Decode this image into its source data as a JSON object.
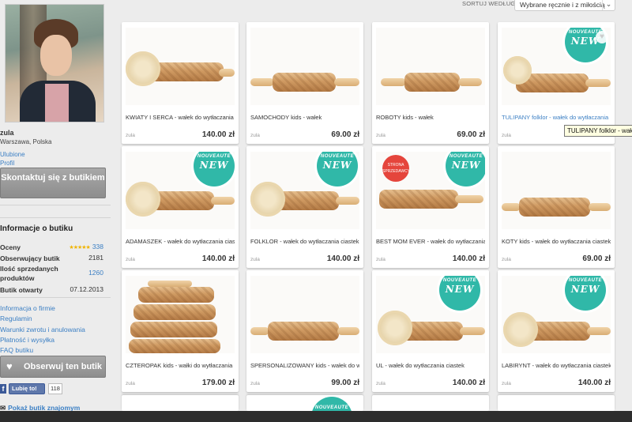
{
  "sidebar": {
    "seller_name": "zula",
    "location": "Warszawa, Polska",
    "favorites_link": "Ulubione",
    "profile_link": "Profil",
    "contact_button": "Skontaktuj się z butikiem",
    "info_title": "Informacje o butiku",
    "info": [
      {
        "label": "Oceny",
        "value": "338",
        "stars": "★★★★★"
      },
      {
        "label": "Obserwujący butik",
        "value": "2181"
      },
      {
        "label": "Ilość sprzedanych produktów",
        "value": "1260"
      },
      {
        "label": "Butik otwarty",
        "value": "07.12.2013"
      }
    ],
    "links": [
      "Informacja o firmie",
      "Regulamin",
      "Warunki zwrotu i anulowania",
      "Płatność i wysyłka",
      "FAQ butiku"
    ],
    "follow_button": "Obserwuj ten butik",
    "fb_like": "Lubię to!",
    "fb_count": "118",
    "show_friends": "Pokaż butik znajomym"
  },
  "sort": {
    "label": "SORTUJ WEDŁUG",
    "selected": "Wybrane ręcznie i z miłością"
  },
  "badge": {
    "fr": "NOUVEAUTE",
    "en": "NEW"
  },
  "red_badge": "STRONA SPRZEDAWCY",
  "tooltip": "TULIPANY folklor - wałek",
  "products": [
    {
      "title": "KWIATY I SERCA - wałek do wytłaczania",
      "seller": "zula",
      "price": "140.00 zł"
    },
    {
      "title": "SAMOCHODY kids - wałek",
      "seller": "zula",
      "price": "69.00 zł"
    },
    {
      "title": "ROBOTY kids - wałek",
      "seller": "zula",
      "price": "69.00 zł"
    },
    {
      "title": "TULIPANY folklor - wałek do wytłaczania",
      "seller": "zula",
      "price": "140.00 zł"
    },
    {
      "title": "ADAMASZEK - wałek do wytłaczania ciastek",
      "seller": "zula",
      "price": "140.00 zł"
    },
    {
      "title": "FOLKLOR - wałek do wytłaczania ciastek",
      "seller": "zula",
      "price": "140.00 zł"
    },
    {
      "title": "BEST MOM EVER - wałek do wytłaczania ciastek",
      "seller": "zula",
      "price": "140.00 zł"
    },
    {
      "title": "KOTY kids - wałek do wytłaczania ciastek",
      "seller": "zula",
      "price": "69.00 zł"
    },
    {
      "title": "CZTEROPAK kids - wałki do wytłaczania",
      "seller": "zula",
      "price": "179.00 zł"
    },
    {
      "title": "SPERSONALIZOWANY kids - wałek do wytłaczania",
      "seller": "zula",
      "price": "99.00 zł"
    },
    {
      "title": "UL - wałek do wytłaczania ciastek",
      "seller": "zula",
      "price": "140.00 zł"
    },
    {
      "title": "LABIRYNT - wałek do wytłaczania ciastek",
      "seller": "zula",
      "price": "140.00 zł"
    }
  ]
}
